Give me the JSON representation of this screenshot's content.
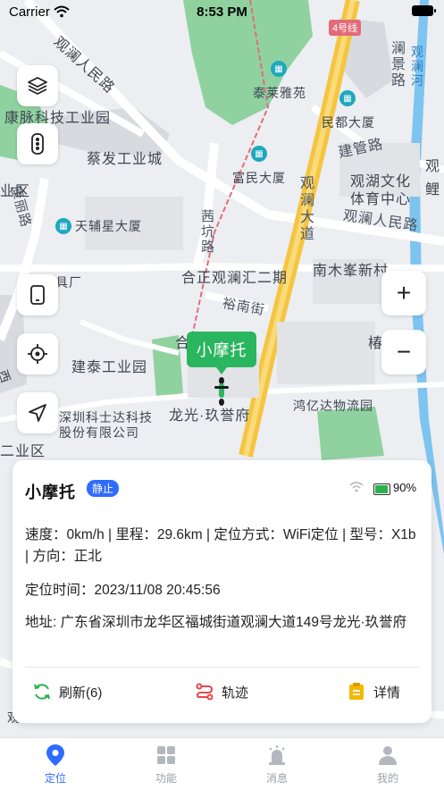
{
  "status_bar": {
    "carrier": "Carrier",
    "time": "8:53 PM"
  },
  "map": {
    "labels": {
      "guanlan_renmin_road_top": "观澜人民路",
      "kangmai_park": "康脉科技工业园",
      "caifa_park": "蔡发工业城",
      "kangli_road": "康丽路",
      "ye_qu": "业区",
      "tianfuxing": "天辅星大厦",
      "furniture_factory": "具厂",
      "taelai_yayuan": "泰莱雅苑",
      "fumin_dasha": "富民大厦",
      "mindu_dasha": "民都大厦",
      "jianguan_road": "建管路",
      "guanhu_culture_1": "观湖文化",
      "guanhu_culture_2": "体育中心",
      "guanlan_renmin_road_right": "观澜人民路",
      "lanjing_road": "澜景路",
      "guanlan_river": "观澜河",
      "guanlan_dadao": "观澜大道",
      "maogong_road": "茜坑路",
      "hezheng": "合正观澜汇二期",
      "nanmu_village": "南木峯新村",
      "yunan_street": "裕南街",
      "jiantai_park": "建泰工业园",
      "shenzhen_kesida_1": "深圳科士达科技",
      "shenzhen_kesida_2": "股份有限公司",
      "longguang": "龙光·玖誉府",
      "hongyida": "鸿亿达物流园",
      "er_ye_qu": "二业区",
      "metro_line4": "4号线",
      "jiu_label": "椿",
      "he_label": "合",
      "xi_label": "西",
      "guan_label": "观",
      "ju_label": "鲤",
      "guan_left": "观"
    },
    "marker_label": "小摩托",
    "zoom_in": "+",
    "zoom_out": "−"
  },
  "card": {
    "title": "小摩托",
    "status_badge": "静止",
    "battery": "90%",
    "info_line": "速度：0km/h | 里程：29.6km | 定位方式：WiFi定位 | 型号：X1b | 方向：正北",
    "time_line": "定位时间：2023/11/08 20:45:56",
    "address_line": "地址: 广东省深圳市龙华区福城街道观澜大道149号龙光·玖誉府",
    "actions": {
      "refresh": "刷新(6)",
      "track": "轨迹",
      "detail": "详情"
    }
  },
  "tabbar": {
    "tabs": [
      {
        "label": "定位"
      },
      {
        "label": "功能"
      },
      {
        "label": "消息"
      },
      {
        "label": "我的"
      }
    ]
  },
  "colors": {
    "accent": "#2f6bff",
    "marker_green": "#2ab55f",
    "road_yellow": "#f5c542"
  }
}
